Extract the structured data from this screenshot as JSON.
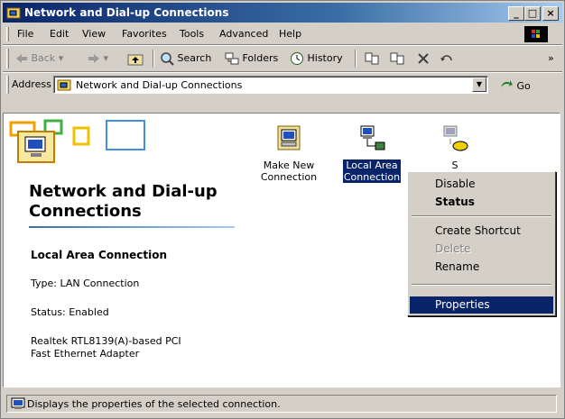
{
  "window": {
    "title": "Network and Dial-up Connections"
  },
  "menu": [
    "File",
    "Edit",
    "View",
    "Favorites",
    "Tools",
    "Advanced",
    "Help"
  ],
  "toolbar": {
    "back": "Back",
    "search": "Search",
    "folders": "Folders",
    "history": "History",
    "overflow": "»"
  },
  "address": {
    "label": "Address",
    "value": "Network and Dial-up Connections",
    "go": "Go"
  },
  "left_pane": {
    "title": "Network and Dial-up Connections",
    "selected_name": "Local Area Connection",
    "type": "Type: LAN Connection",
    "status": "Status: Enabled",
    "adapter_line1": "Realtek RTL8139(A)-based PCI",
    "adapter_line2": "Fast Ethernet Adapter"
  },
  "icons": [
    {
      "label_line1": "Make New",
      "label_line2": "Connection",
      "icon": "make-new-connection-icon"
    },
    {
      "label_line1": "Local Area",
      "label_line2": "Connection",
      "icon": "lan-connection-icon",
      "selected": true
    },
    {
      "label_line1": "S",
      "label_line2": "",
      "icon": "dialup-connection-icon"
    }
  ],
  "context_menu": {
    "disable": "Disable",
    "status": "Status",
    "create_shortcut": "Create Shortcut",
    "delete": "Delete",
    "rename": "Rename",
    "properties": "Properties"
  },
  "statusbar": {
    "text": "Displays the properties of the selected connection."
  },
  "colors": {
    "titlebar": "#0a246a",
    "selection": "#0a246a",
    "face": "#d4d0c8"
  }
}
